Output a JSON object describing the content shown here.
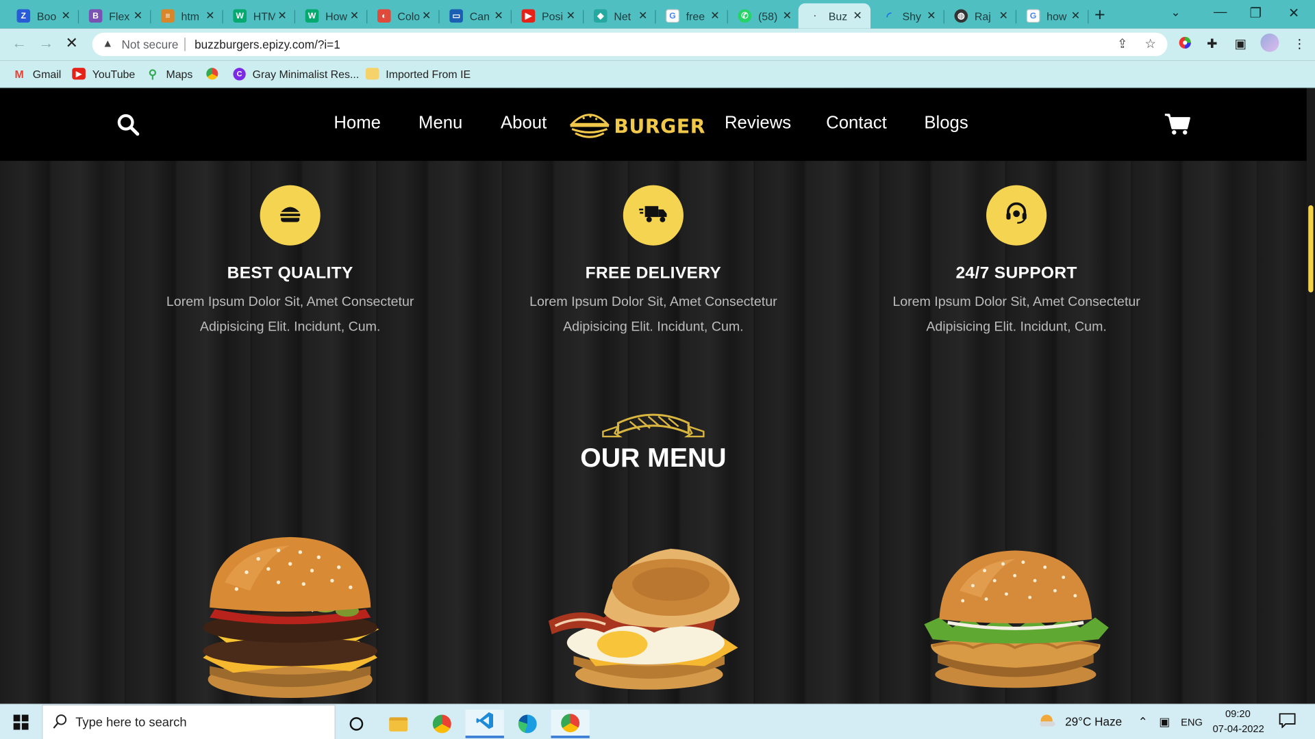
{
  "browser": {
    "tabs": [
      {
        "title": "Boo",
        "icon": "zoho-icon",
        "color": "#2a5bd7"
      },
      {
        "title": "Flex",
        "icon": "bootstrap-icon",
        "color": "#7952b3"
      },
      {
        "title": "htm",
        "icon": "stack-icon",
        "color": "#d9852a"
      },
      {
        "title": "HTM",
        "icon": "w3-icon",
        "color": "#04aa6d"
      },
      {
        "title": "How",
        "icon": "w3-icon",
        "color": "#04aa6d"
      },
      {
        "title": "Colo",
        "icon": "palette-icon",
        "color": "#e04a3a"
      },
      {
        "title": "Can",
        "icon": "monitor-icon",
        "color": "#1a5fb4"
      },
      {
        "title": "Posi",
        "icon": "youtube-icon",
        "color": "#e62117"
      },
      {
        "title": "Net",
        "icon": "netlify-icon",
        "color": "#25a8a0"
      },
      {
        "title": "free",
        "icon": "google-icon",
        "color": "#4285f4"
      },
      {
        "title": "(58)",
        "icon": "whatsapp-icon",
        "color": "#25d366"
      },
      {
        "title": "Buz",
        "icon": "dot-icon",
        "color": "#555555",
        "active": true
      },
      {
        "title": "Shy",
        "icon": "loading-icon",
        "color": "#1a73e8"
      },
      {
        "title": "Raj",
        "icon": "globe-icon",
        "color": "#333333"
      },
      {
        "title": "how",
        "icon": "google-icon",
        "color": "#4285f4"
      }
    ],
    "security_label": "Not secure",
    "url": "buzzburgers.epizy.com/?i=1",
    "bookmarks": [
      {
        "label": "Gmail",
        "icon": "gmail-icon",
        "color": "#ea4335"
      },
      {
        "label": "YouTube",
        "icon": "youtube-icon",
        "color": "#e62117"
      },
      {
        "label": "Maps",
        "icon": "maps-icon",
        "color": "#34a853"
      },
      {
        "label": "",
        "icon": "chrome-icon",
        "color": "#4285f4"
      },
      {
        "label": "Gray Minimalist Res...",
        "icon": "canva-icon",
        "color": "#7d2ae8"
      },
      {
        "label": "Imported From IE",
        "icon": "folder-icon",
        "color": "#f6d26b"
      }
    ]
  },
  "site": {
    "nav": {
      "home": "Home",
      "menu": "Menu",
      "about": "About",
      "reviews": "Reviews",
      "contact": "Contact",
      "blogs": "Blogs"
    },
    "logo_text": "BURGER",
    "features": [
      {
        "title": "BEST QUALITY",
        "icon": "burger-icon",
        "line1": "Lorem Ipsum Dolor Sit, Amet Consectetur",
        "line2": "Adipisicing Elit. Incidunt, Cum."
      },
      {
        "title": "FREE DELIVERY",
        "icon": "delivery-truck-icon",
        "line1": "Lorem Ipsum Dolor Sit, Amet Consectetur",
        "line2": "Adipisicing Elit. Incidunt, Cum."
      },
      {
        "title": "24/7 SUPPORT",
        "icon": "headset-icon",
        "line1": "Lorem Ipsum Dolor Sit, Amet Consectetur",
        "line2": "Adipisicing Elit. Incidunt, Cum."
      }
    ],
    "menu_heading": "OUR MENU",
    "accent": "#f4d451"
  },
  "taskbar": {
    "search_placeholder": "Type here to search",
    "weather": "29°C  Haze",
    "lang": "ENG",
    "time": "09:20",
    "date": "07-04-2022"
  }
}
